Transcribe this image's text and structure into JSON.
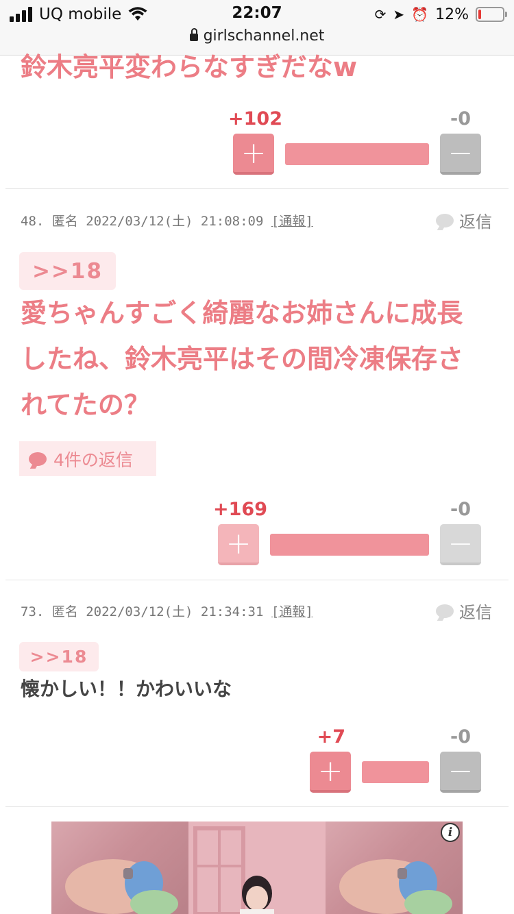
{
  "status_bar": {
    "carrier": "UQ mobile",
    "time": "22:07",
    "battery": "12%",
    "battery_level": 0.12,
    "url": "girlschannel.net"
  },
  "comments": [
    {
      "body": "鈴木亮平変わらなすぎだなw",
      "plus": "+102",
      "minus": "-0",
      "plus_ratio": 1.0
    },
    {
      "meta": "48. 匿名 2022/03/12(土) 21:08:09",
      "report": "[通報]",
      "reply": "返信",
      "anchor": ">>18",
      "body_lines": [
        "愛ちゃんすごく綺麗なお姉さんに成長",
        "したね、鈴木亮平はその間冷凍保存さ",
        "れてたの？"
      ],
      "replies_button": "4件の返信",
      "plus": "+169",
      "minus": "-0",
      "plus_ratio": 1.0
    },
    {
      "meta": "73. 匿名 2022/03/12(土) 21:34:31",
      "report": "[通報]",
      "reply": "返信",
      "anchor": ">>18",
      "body": "懐かしい！！かわいいな",
      "plus": "+7",
      "minus": "-0",
      "plus_ratio": 1.0
    }
  ],
  "ad": {
    "info": "i"
  },
  "colors": {
    "accent_pink": "#ec7d85",
    "plus_red": "#e04a54",
    "minus_gray": "#999999"
  }
}
